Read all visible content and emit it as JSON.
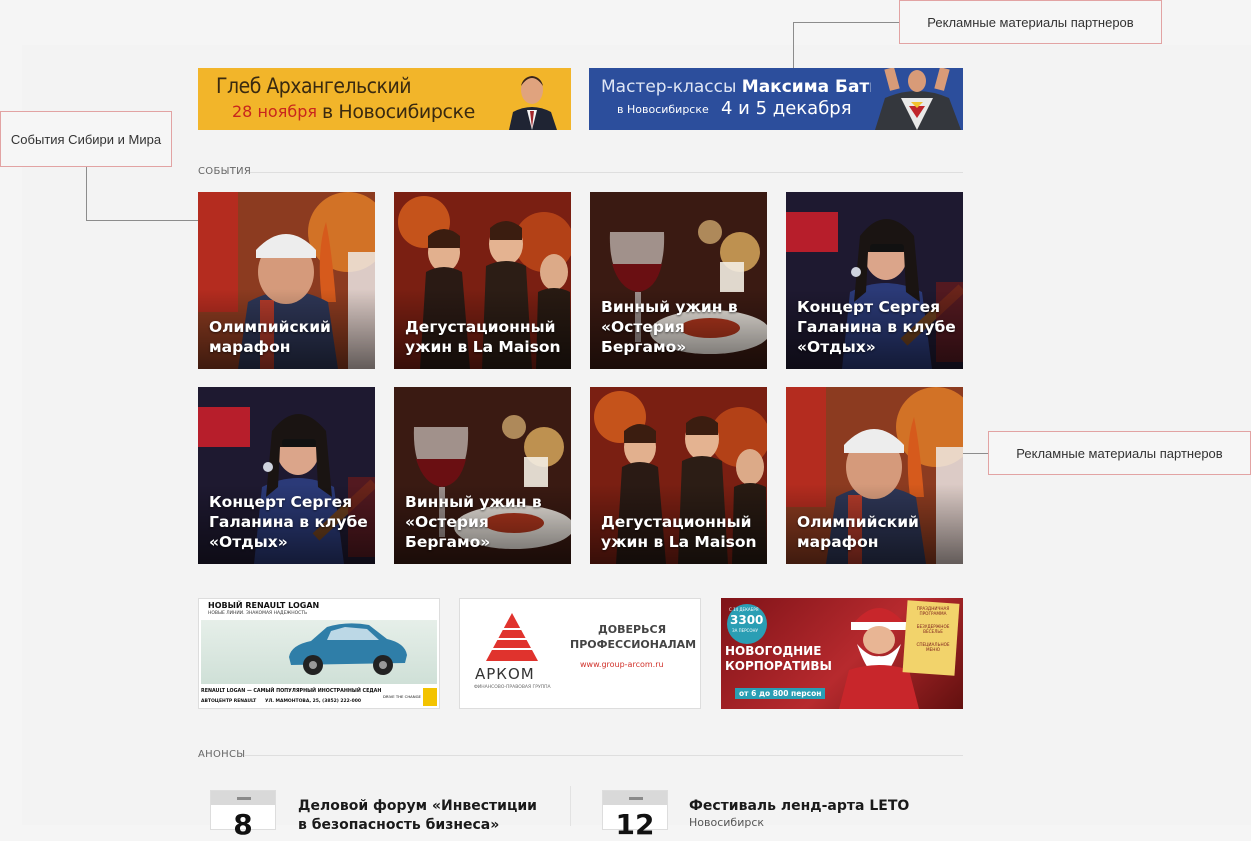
{
  "callouts": {
    "partners_top": "Рекламные материалы партнеров",
    "events": "События Сибири и Мира",
    "partners_right": "Рекламные материалы партнеров"
  },
  "banners": {
    "left": {
      "name": "Глеб Архангельский",
      "date": "28 ноября",
      "city": "в Новосибирске"
    },
    "right": {
      "prefix": "Мастер-классы",
      "name": "Максима Батырева",
      "city": "в Новосибирске",
      "dates": "4 и 5 декабря"
    }
  },
  "events": {
    "title": "СОБЫТИЯ",
    "tiles": [
      {
        "caption": "Олимпийский марафон"
      },
      {
        "caption": "Дегустационный ужин в La Maison"
      },
      {
        "caption": "Винный ужин в «Остерия Бергамо»"
      },
      {
        "caption": "Концерт Сергея Галанина в клубе «Отдых»"
      },
      {
        "caption": "Концерт Сергея Галанина в клубе «Отдых»"
      },
      {
        "caption": "Винный ужин в «Остерия Бергамо»"
      },
      {
        "caption": "Дегустационный ужин в La Maison"
      },
      {
        "caption": "Олимпийский марафон"
      }
    ]
  },
  "ads": {
    "renault": {
      "headline": "НОВЫЙ RENAULT LOGAN",
      "sub": "НОВЫЕ ЛИНИИ. ЗНАКОМАЯ НАДЕЖНОСТЬ",
      "footer": "RENAULT LOGAN — САМЫЙ ПОПУЛЯРНЫЙ ИНОСТРАННЫЙ СЕДАН",
      "dealer": "АВТОЦЕНТР RENAULT",
      "address": "УЛ. МАМОНТОВА, 25, (3852) 222-000",
      "slogan": "DRIVE THE CHANGE"
    },
    "arkom": {
      "brand": "АРКОМ",
      "tagline": "ФИНАНСОВО-ПРАВОВАЯ ГРУППА",
      "line1": "ДОВЕРЬСЯ",
      "line2": "ПРОФЕССИОНАЛАМ",
      "url": "www.group-arcom.ru"
    },
    "corporate": {
      "date": "С 14 ДЕКАБРЯ",
      "price": "3300",
      "per": "ЗА ПЕРСОНУ",
      "title1": "НОВОГОДНИЕ",
      "title2": "КОРПОРАТИВЫ",
      "guests": "от 6 до 800 персон",
      "note1": "ПРАЗДНИЧНАЯ ПРОГРАММА",
      "note2": "БЕЗУДЕРЖНОЕ ВЕСЕЛЬЕ",
      "note3": "СПЕЦИАЛЬНОЕ МЕНЮ"
    }
  },
  "announcements": {
    "title": "АНОНСЫ",
    "items": [
      {
        "day": "8",
        "title": "Деловой форум «Инвестиции в безопасность бизнеса»",
        "sub": ""
      },
      {
        "day": "12",
        "title": "Фестиваль ленд-арта LETO",
        "sub": "Новосибирск"
      }
    ]
  },
  "colors": {
    "accent_red": "#c8261d",
    "banner_yellow": "#f2b52a",
    "banner_blue": "#2c4e9c"
  }
}
